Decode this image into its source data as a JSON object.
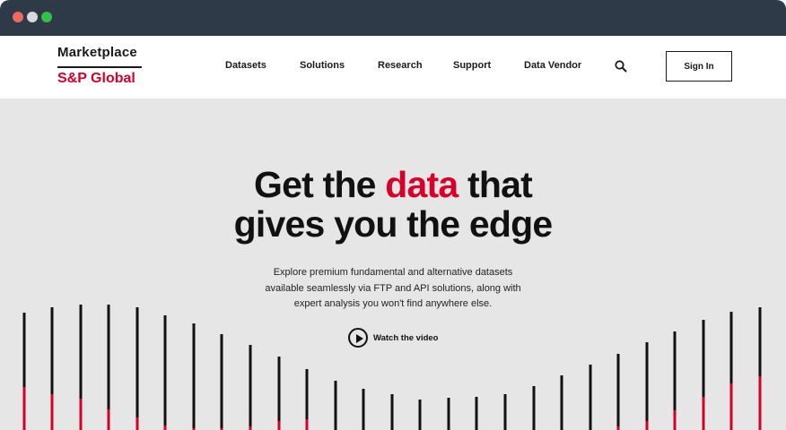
{
  "window": {
    "controls": [
      "close",
      "minimize",
      "maximize"
    ]
  },
  "brand": {
    "top": "Marketplace",
    "bottom": "S&P Global",
    "accent_color": "#d6002a"
  },
  "nav": {
    "items": [
      {
        "label": "Datasets"
      },
      {
        "label": "Solutions"
      },
      {
        "label": "Research"
      },
      {
        "label": "Support"
      },
      {
        "label": "Data Vendor"
      }
    ],
    "search_icon": "search-icon",
    "signin_label": "Sign In"
  },
  "hero": {
    "headline_pre": "Get the ",
    "headline_accent": "data",
    "headline_post": " that",
    "headline_line2": "gives you the edge",
    "sub_line1": "Explore premium fundamental and alternative datasets",
    "sub_line2": "available seamlessly via FTP and API solutions, along with",
    "sub_line3": "expert analysis you won't find anywhere else.",
    "video_label": "Watch the video",
    "video_icon": "play-icon"
  }
}
